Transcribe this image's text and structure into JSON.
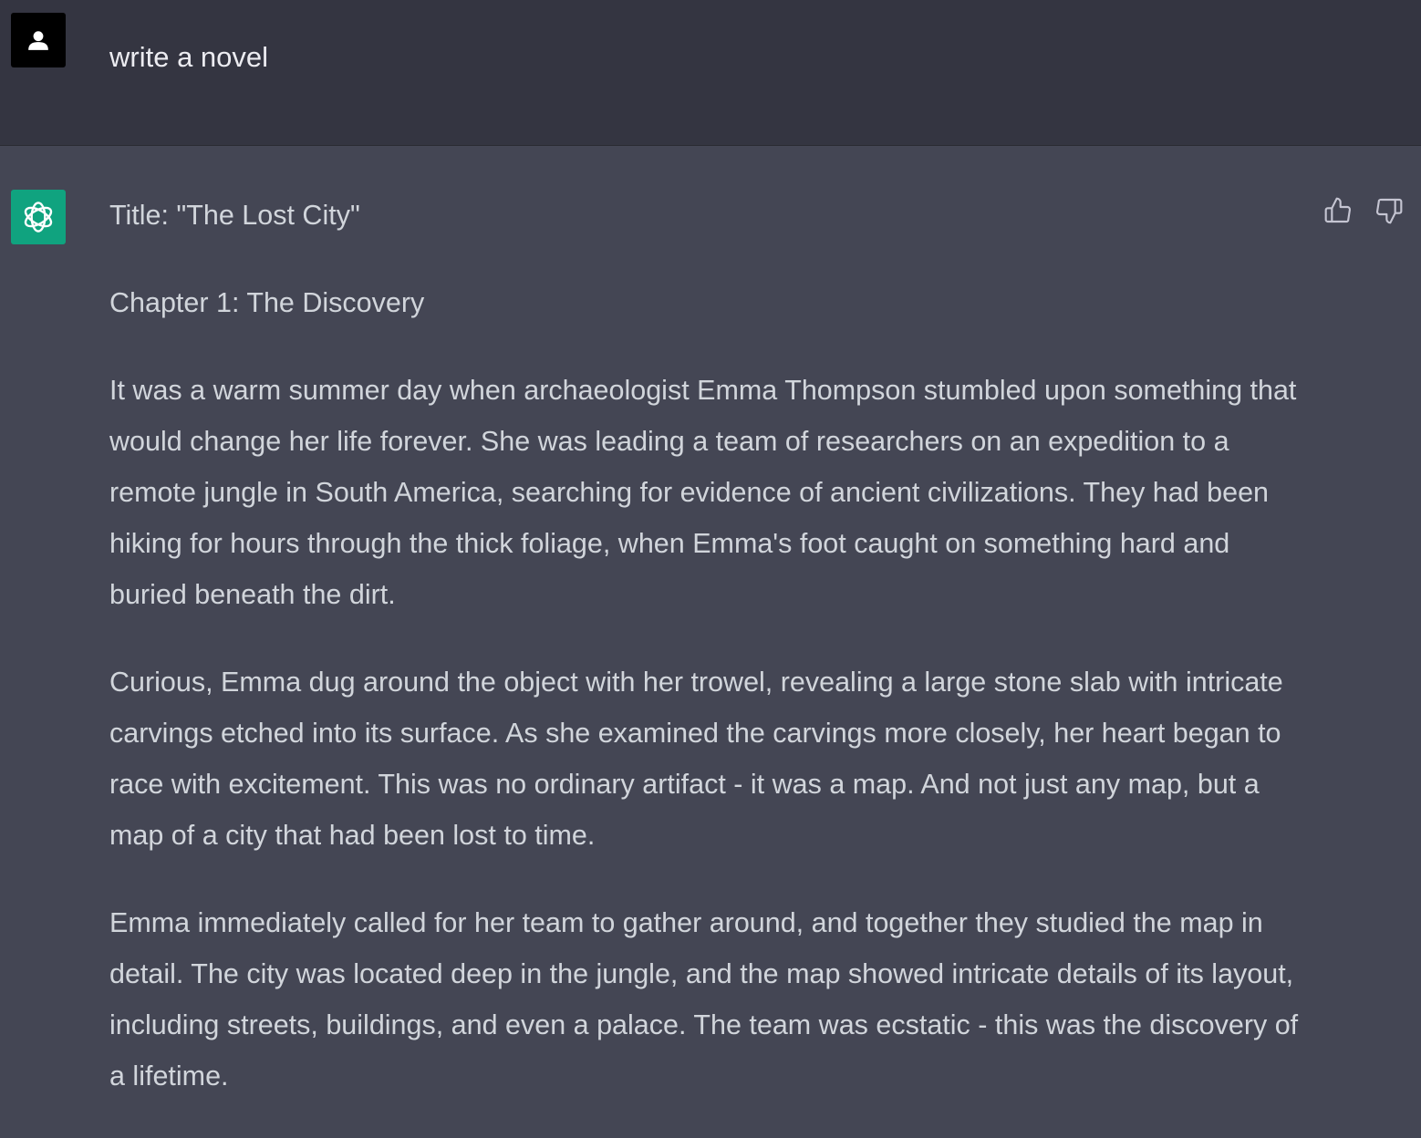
{
  "conversation": {
    "user": {
      "avatar_icon": "user-icon",
      "message": "write a novel"
    },
    "assistant": {
      "avatar_icon": "openai-logo-icon",
      "accent_color": "#10a37f",
      "paragraphs": [
        "Title: \"The Lost City\"",
        "Chapter 1: The Discovery",
        "It was a warm summer day when archaeologist Emma Thompson stumbled upon something that would change her life forever. She was leading a team of researchers on an expedition to a remote jungle in South America, searching for evidence of ancient civilizations. They had been hiking for hours through the thick foliage, when Emma's foot caught on something hard and buried beneath the dirt.",
        "Curious, Emma dug around the object with her trowel, revealing a large stone slab with intricate carvings etched into its surface. As she examined the carvings more closely, her heart began to race with excitement. This was no ordinary artifact - it was a map. And not just any map, but a map of a city that had been lost to time.",
        "Emma immediately called for her team to gather around, and together they studied the map in detail. The city was located deep in the jungle, and the map showed intricate details of its layout, including streets, buildings, and even a palace. The team was ecstatic - this was the discovery of a lifetime."
      ],
      "feedback": {
        "thumbs_up_icon": "thumbs-up-icon",
        "thumbs_down_icon": "thumbs-down-icon"
      }
    }
  },
  "colors": {
    "user_row_bg": "#343541",
    "assistant_row_bg": "#444654",
    "user_text": "#ececf1",
    "assistant_text": "#d1d5db"
  }
}
